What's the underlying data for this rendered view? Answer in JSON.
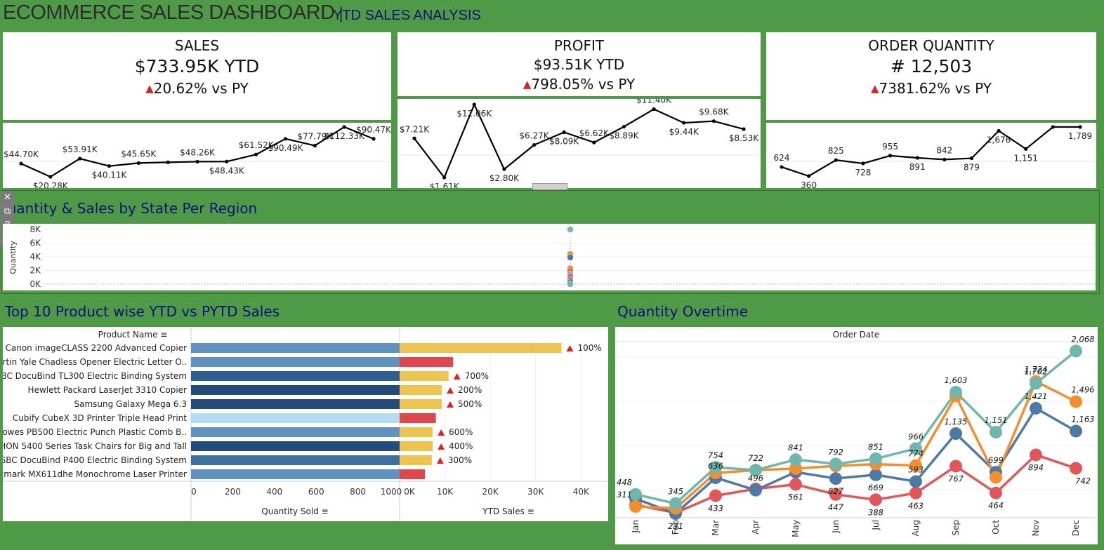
{
  "header": {
    "title": "ECOMMERCE SALES DASHBOARD",
    "separator": "|",
    "subtitle": "YTD SALES ANALYSIS"
  },
  "kpis": {
    "sales": {
      "title": "SALES",
      "value": "$733.95K YTD",
      "delta": "20.62% vs PY"
    },
    "profit": {
      "title": "PROFIT",
      "value": "$93.51K YTD",
      "delta": "798.05% vs PY"
    },
    "quantity": {
      "title": "ORDER QUANTITY",
      "value": "# 12,503",
      "delta": "7381.62% vs PY"
    }
  },
  "colors": {
    "background": "#4f9a46",
    "line": "#000000",
    "teal": "#6fb7ad",
    "orange": "#f28e2b",
    "blue": "#4e79a7",
    "red": "#e15759",
    "bar_blue": "#5f92bf",
    "bar_yellow": "#ecc44f",
    "bar_red": "#e0474c",
    "triangle": "#e02020",
    "title_blue": "#10107a"
  },
  "sparklines": {
    "sales": {
      "labels": [
        "$44.70K",
        "$20.28K",
        "$53.91K",
        "$40.11K",
        "$45.65K",
        "",
        "$48.26K",
        "$48.43K",
        "$61.52K",
        "$90.49K",
        "$77.79K",
        "$112.33K",
        "$90.47K"
      ],
      "values": [
        44.7,
        20.28,
        53.91,
        40.11,
        45.65,
        47.0,
        48.26,
        48.43,
        61.52,
        90.49,
        77.79,
        112.33,
        90.47
      ]
    },
    "profit": {
      "labels": [
        "$7.21K",
        "$1.61K",
        "$12.06K",
        "$2.80K",
        "$6.27K",
        "$8.09K",
        "$6.62K",
        "$8.89K",
        "$11.40K",
        "$9.44K",
        "$9.68K",
        "$8.53K"
      ],
      "values": [
        7.21,
        1.61,
        12.06,
        2.8,
        6.27,
        8.09,
        6.62,
        8.89,
        11.4,
        9.44,
        9.68,
        8.53
      ]
    },
    "quantity": {
      "labels": [
        "624",
        "360",
        "825",
        "728",
        "955",
        "891",
        "842",
        "879",
        "1,676",
        "1,151",
        "",
        "1,789"
      ],
      "values": [
        624,
        360,
        825,
        728,
        955,
        891,
        842,
        879,
        1676,
        1151,
        1789,
        1789
      ]
    }
  },
  "region_chart": {
    "title": "Quantity & Sales by State Per Region",
    "ylabel": "Quantity",
    "yticks": [
      "8K",
      "6K",
      "4K",
      "2K",
      "0K"
    ],
    "points": [
      {
        "value": 8000,
        "color": "#6fb7ad"
      },
      {
        "value": 4400,
        "color": "#f28e2b"
      },
      {
        "value": 3900,
        "color": "#4e79a7"
      },
      {
        "value": 2300,
        "color": "#f28e2b"
      },
      {
        "value": 1900,
        "color": "#e15759"
      },
      {
        "value": 1500,
        "color": "#76b7b2"
      },
      {
        "value": 1100,
        "color": "#e15759"
      },
      {
        "value": 700,
        "color": "#b07aa1"
      },
      {
        "value": 300,
        "color": "#4e79a7"
      },
      {
        "value": 0,
        "color": "#6fb7ad"
      }
    ]
  },
  "products": {
    "title": "Top 10 Product wise YTD vs PYTD Sales",
    "header": "Product Name",
    "xlabel_qty": "Quantity Sold",
    "xlabel_sales": "YTD Sales",
    "qty_ticks": [
      "0",
      "200",
      "400",
      "600",
      "800",
      "1000"
    ],
    "sales_ticks": [
      "0K",
      "10K",
      "20K",
      "30K",
      "40K"
    ],
    "rows": [
      {
        "name": "Canon imageCLASS 2200 Advanced Copier",
        "qty": 1000,
        "sales": 35.7,
        "growth": "100%",
        "bar": "#5f92bf",
        "sales_color": "#ecc44f"
      },
      {
        "name": "Martin Yale Chadless Opener Electric Letter O..",
        "qty": 1000,
        "sales": 11.8,
        "growth": "",
        "bar": "#5f92bf",
        "sales_color": "#e0474c"
      },
      {
        "name": "GBC DocuBind TL300 Electric Binding System",
        "qty": 1000,
        "sales": 10.8,
        "growth": "700%",
        "bar": "#2f5f92",
        "sales_color": "#ecc44f"
      },
      {
        "name": "Hewlett Packard LaserJet 3310 Copier",
        "qty": 1000,
        "sales": 9.3,
        "growth": "200%",
        "bar": "#234c7c",
        "sales_color": "#ecc44f"
      },
      {
        "name": "Samsung Galaxy Mega 6.3",
        "qty": 1000,
        "sales": 9.3,
        "growth": "500%",
        "bar": "#234c7c",
        "sales_color": "#ecc44f"
      },
      {
        "name": "Cubify CubeX 3D Printer Triple Head Print",
        "qty": 1000,
        "sales": 8.0,
        "growth": "",
        "bar": "#b6dcf2",
        "sales_color": "#e0474c"
      },
      {
        "name": "Fellowes PB500 Electric Punch Plastic Comb B..",
        "qty": 1000,
        "sales": 7.3,
        "growth": "600%",
        "bar": "#5f92bf",
        "sales_color": "#ecc44f"
      },
      {
        "name": "HON 5400 Series Task Chairs for Big and Tall",
        "qty": 1000,
        "sales": 7.3,
        "growth": "400%",
        "bar": "#234c7c",
        "sales_color": "#ecc44f"
      },
      {
        "name": "GBC DocuBind P400 Electric Binding System",
        "qty": 1000,
        "sales": 7.1,
        "growth": "300%",
        "bar": "#3d6f9f",
        "sales_color": "#ecc44f"
      },
      {
        "name": "Lexmark MX611dhe Monochrome Laser Printer",
        "qty": 1000,
        "sales": 5.6,
        "growth": "",
        "bar": "#5f92bf",
        "sales_color": "#e0474c"
      }
    ]
  },
  "chart_data": {
    "type": "line",
    "title": "Quantity Overtime",
    "xlabel": "Order Date",
    "ylabel": "",
    "categories": [
      "Jan",
      "Feb",
      "Mar",
      "Apr",
      "May",
      "Jun",
      "Jul",
      "Aug",
      "Sep",
      "Oct",
      "Nov",
      "Dec"
    ],
    "ylim": [
      200,
      2150
    ],
    "series": [
      {
        "color": "#6fb7ad",
        "values": [
          448,
          345,
          754,
          722,
          841,
          792,
          851,
          966,
          1603,
          1151,
          1702,
          2068
        ],
        "labels": [
          "448",
          "345",
          "754",
          "",
          "841",
          "792",
          "851",
          "966",
          "1,603",
          "1,151",
          "1,702",
          "2,068"
        ]
      },
      {
        "color": "#f28e2b",
        "values": [
          311,
          290,
          690,
          722,
          740,
          770,
          790,
          774,
          1560,
          640,
          1724,
          1496
        ],
        "labels": [
          "311",
          "",
          "",
          "722",
          "",
          "",
          "",
          "774",
          "",
          "",
          "1,724",
          "1,496"
        ]
      },
      {
        "color": "#4e79a7",
        "values": [
          400,
          231,
          636,
          496,
          700,
          627,
          669,
          593,
          1135,
          699,
          1421,
          1163
        ],
        "labels": [
          "",
          "231",
          "636",
          "496",
          "",
          "627",
          "669",
          "593",
          "1,135",
          "699",
          "1,421",
          "1,163"
        ]
      },
      {
        "color": "#e15759",
        "values": [
          330,
          240,
          433,
          510,
          561,
          447,
          388,
          463,
          767,
          464,
          894,
          742
        ],
        "labels": [
          "",
          "",
          "433",
          "",
          "561",
          "447",
          "388",
          "463",
          "767",
          "464",
          "894",
          "742"
        ]
      }
    ]
  }
}
